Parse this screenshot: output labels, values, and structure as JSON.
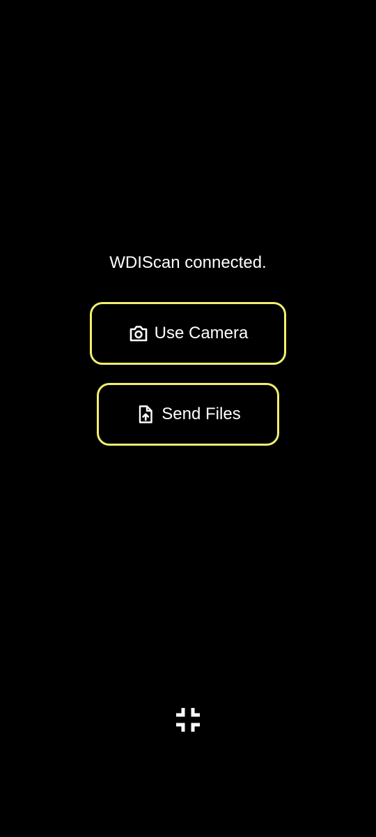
{
  "status": {
    "text": "WDIScan connected."
  },
  "buttons": {
    "camera": {
      "label": "Use Camera",
      "icon": "camera-icon"
    },
    "files": {
      "label": "Send Files",
      "icon": "file-upload-icon"
    }
  },
  "controls": {
    "exit_fullscreen_icon": "fullscreen-exit-icon"
  },
  "colors": {
    "background": "#000000",
    "text": "#ffffff",
    "button_border": "#f2ef6e"
  }
}
